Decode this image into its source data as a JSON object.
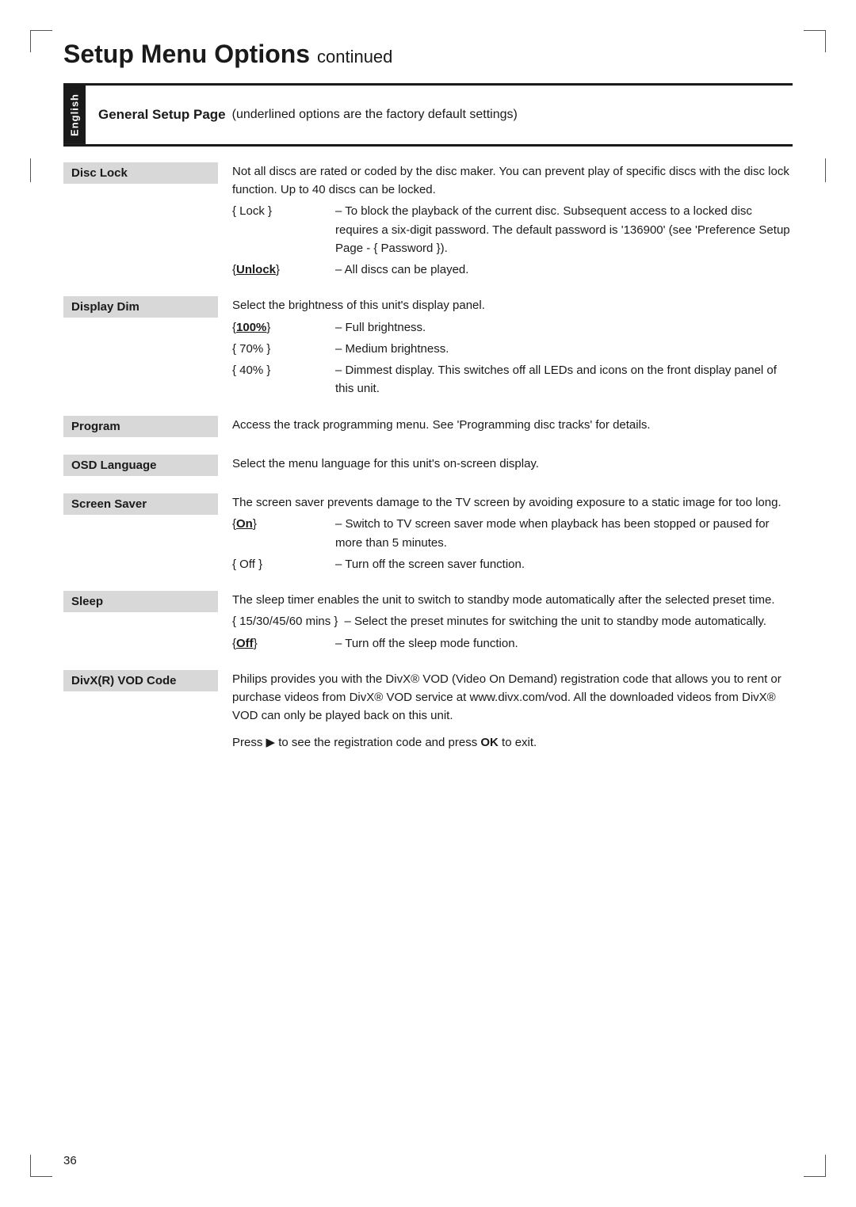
{
  "page": {
    "title": "Setup Menu Options",
    "title_continued": "continued",
    "section_title": "General Setup Page",
    "section_subtitle": "(underlined options are the factory default settings)",
    "sidebar_label": "English",
    "page_number": "36"
  },
  "menu_items": [
    {
      "label": "Disc Lock",
      "description": "Not all discs are rated or coded by the disc maker. You can prevent play of specific discs with the disc lock function. Up to 40 discs can be locked.",
      "options": [
        {
          "key": "{ Lock }",
          "key_style": "normal",
          "desc": "– To block the playback of the current disc. Subsequent access to a locked disc requires a six-digit password. The default password is '136900' (see 'Preference Setup Page - { Password })."
        },
        {
          "key": "{ Unlock }",
          "key_style": "underline",
          "desc": "– All discs can be played."
        }
      ]
    },
    {
      "label": "Display Dim",
      "description": "Select the brightness of this unit's display panel.",
      "options": [
        {
          "key": "{ 100% }",
          "key_style": "underline bold",
          "desc": "– Full brightness."
        },
        {
          "key": "{ 70% }",
          "key_style": "normal",
          "desc": "– Medium brightness."
        },
        {
          "key": "{ 40% }",
          "key_style": "normal",
          "desc": "– Dimmest display. This switches off all LEDs and icons on the front display panel of this unit."
        }
      ]
    },
    {
      "label": "Program",
      "description": "Access the track programming menu. See 'Programming disc tracks' for details.",
      "options": []
    },
    {
      "label": "OSD Language",
      "description": "Select the menu language for this unit's on-screen display.",
      "options": []
    },
    {
      "label": "Screen Saver",
      "description": "The screen saver prevents damage to the TV screen by avoiding exposure to a static image for too long.",
      "options": [
        {
          "key": "{ On }",
          "key_style": "underline",
          "desc": "– Switch to TV screen saver mode when playback has been stopped or paused for more than 5 minutes."
        },
        {
          "key": "{ Off }",
          "key_style": "normal",
          "desc": "– Turn off the screen saver function."
        }
      ]
    },
    {
      "label": "Sleep",
      "description": "The sleep timer enables the unit to switch to standby mode automatically after the selected preset time.",
      "options": [
        {
          "key": "{ 15/30/45/60 mins }",
          "key_style": "normal",
          "desc": "– Select the preset minutes for switching the unit to standby mode automatically."
        },
        {
          "key": "{ Off }",
          "key_style": "underline",
          "desc": "– Turn off the sleep mode function."
        }
      ]
    },
    {
      "label": "DivX(R) VOD Code",
      "description": "Philips provides you with the DivX® VOD (Video On Demand) registration code that allows you to rent or purchase videos from DivX® VOD service at www.divx.com/vod. All the downloaded videos from DivX® VOD can only be played back on this unit.",
      "options": [],
      "extra": "Press ▶ to see the registration code and press OK to exit."
    }
  ]
}
